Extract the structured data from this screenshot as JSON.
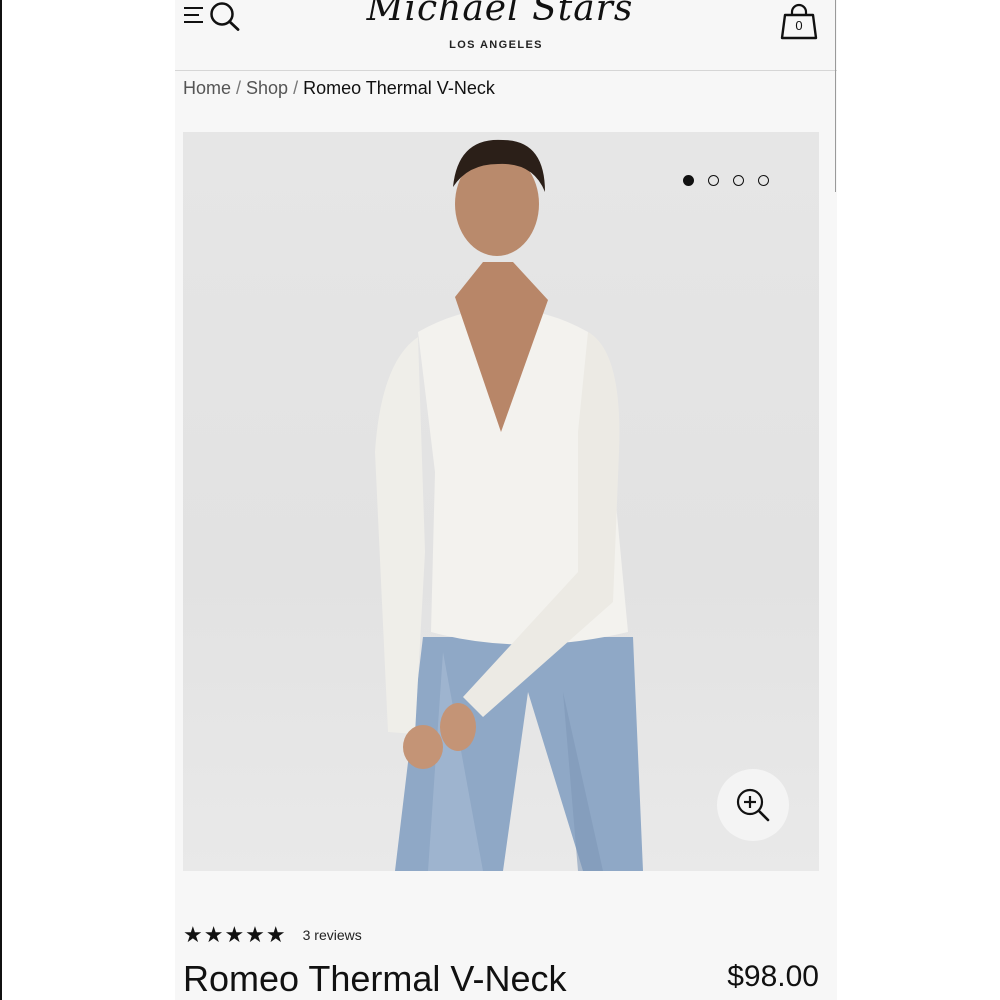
{
  "header": {
    "logo_text": "Michael Stars",
    "logo_subtitle": "LOS ANGELES",
    "cart_count": "0",
    "icons": {
      "menu": "hamburger-icon",
      "search": "search-icon",
      "cart": "shopping-bag-icon"
    }
  },
  "breadcrumb": {
    "items": [
      "Home",
      "Shop"
    ],
    "separator": "/",
    "current": "Romeo Thermal V-Neck"
  },
  "gallery": {
    "image_count": 4,
    "active_index": 0,
    "zoom_icon": "zoom-in-icon",
    "image_subject": "woman-in-white-thermal-v-neck-and-jeans"
  },
  "product": {
    "rating_stars": "★★★★★",
    "rating_value": 5,
    "reviews_label": "3 reviews",
    "name": "Romeo Thermal V-Neck",
    "price": "$98.00"
  },
  "colors": {
    "background": "#f7f7f7",
    "text": "#111111",
    "image_bg": "#e4e4e4",
    "garment": "#f3f2ee",
    "denim": "#8fa8c6"
  }
}
